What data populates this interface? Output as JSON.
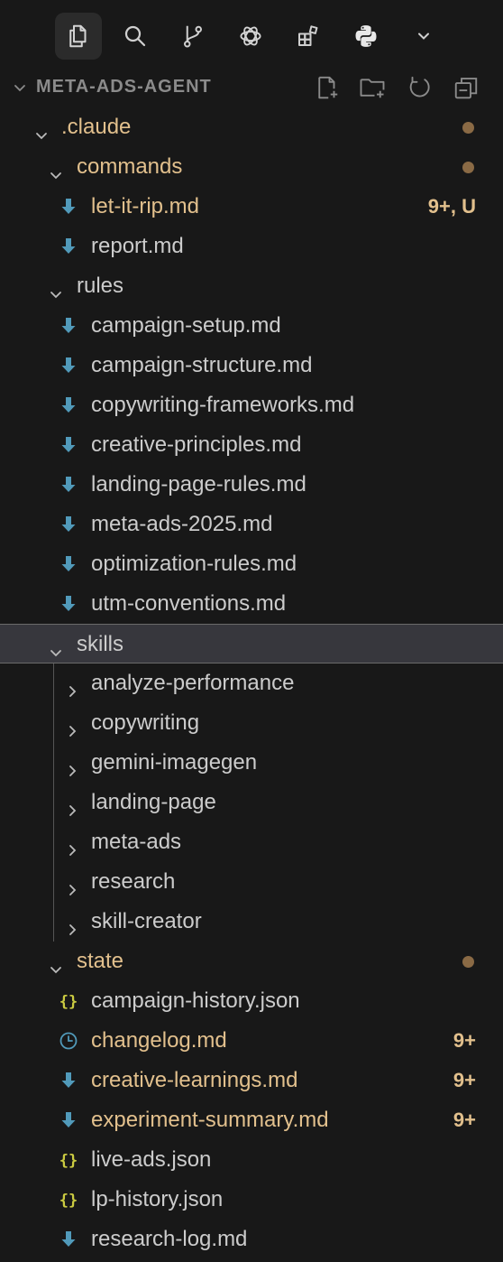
{
  "colors": {
    "background": "#181818",
    "text": "#cccccc",
    "modified": "#e2c08d",
    "muted_header": "#8b8b8b",
    "markdown_icon": "#519aba",
    "json_icon": "#cbcb41",
    "dot": "#8a6a45"
  },
  "activity_bar": [
    {
      "icon": "files-icon",
      "active": true
    },
    {
      "icon": "search-icon",
      "active": false
    },
    {
      "icon": "source-control-icon",
      "active": false
    },
    {
      "icon": "openai-icon",
      "active": false
    },
    {
      "icon": "extensions-icon",
      "active": false
    },
    {
      "icon": "python-icon",
      "active": false
    },
    {
      "icon": "chevron-down-icon",
      "active": false
    }
  ],
  "explorer": {
    "title": "META-ADS-AGENT",
    "actions": [
      "new-file-icon",
      "new-folder-icon",
      "refresh-icon",
      "collapse-all-icon"
    ]
  },
  "tree": [
    {
      "label": ".claude",
      "type": "folder",
      "expanded": true,
      "depth": 0,
      "status": "modified",
      "dot": true
    },
    {
      "label": "commands",
      "type": "folder",
      "expanded": true,
      "depth": 1,
      "status": "modified",
      "dot": true
    },
    {
      "label": "let-it-rip.md",
      "type": "md",
      "depth": 2,
      "status": "modified",
      "badge": "9+, U"
    },
    {
      "label": "report.md",
      "type": "md",
      "depth": 2
    },
    {
      "label": "rules",
      "type": "folder",
      "expanded": true,
      "depth": 1
    },
    {
      "label": "campaign-setup.md",
      "type": "md",
      "depth": 2
    },
    {
      "label": "campaign-structure.md",
      "type": "md",
      "depth": 2
    },
    {
      "label": "copywriting-frameworks.md",
      "type": "md",
      "depth": 2
    },
    {
      "label": "creative-principles.md",
      "type": "md",
      "depth": 2
    },
    {
      "label": "landing-page-rules.md",
      "type": "md",
      "depth": 2
    },
    {
      "label": "meta-ads-2025.md",
      "type": "md",
      "depth": 2
    },
    {
      "label": "optimization-rules.md",
      "type": "md",
      "depth": 2
    },
    {
      "label": "utm-conventions.md",
      "type": "md",
      "depth": 2
    },
    {
      "label": "skills",
      "type": "folder",
      "expanded": true,
      "depth": 1,
      "selected": true
    },
    {
      "label": "analyze-performance",
      "type": "folder",
      "expanded": false,
      "depth": 2
    },
    {
      "label": "copywriting",
      "type": "folder",
      "expanded": false,
      "depth": 2
    },
    {
      "label": "gemini-imagegen",
      "type": "folder",
      "expanded": false,
      "depth": 2
    },
    {
      "label": "landing-page",
      "type": "folder",
      "expanded": false,
      "depth": 2
    },
    {
      "label": "meta-ads",
      "type": "folder",
      "expanded": false,
      "depth": 2
    },
    {
      "label": "research",
      "type": "folder",
      "expanded": false,
      "depth": 2
    },
    {
      "label": "skill-creator",
      "type": "folder",
      "expanded": false,
      "depth": 2
    },
    {
      "label": "state",
      "type": "folder",
      "expanded": true,
      "depth": 1,
      "status": "modified",
      "dot": true
    },
    {
      "label": "campaign-history.json",
      "type": "json",
      "depth": 2
    },
    {
      "label": "changelog.md",
      "type": "clock",
      "depth": 2,
      "status": "modified",
      "badge": "9+"
    },
    {
      "label": "creative-learnings.md",
      "type": "md",
      "depth": 2,
      "status": "modified",
      "badge": "9+"
    },
    {
      "label": "experiment-summary.md",
      "type": "md",
      "depth": 2,
      "status": "modified",
      "badge": "9+"
    },
    {
      "label": "live-ads.json",
      "type": "json",
      "depth": 2
    },
    {
      "label": "lp-history.json",
      "type": "json",
      "depth": 2
    },
    {
      "label": "research-log.md",
      "type": "md",
      "depth": 2
    }
  ]
}
